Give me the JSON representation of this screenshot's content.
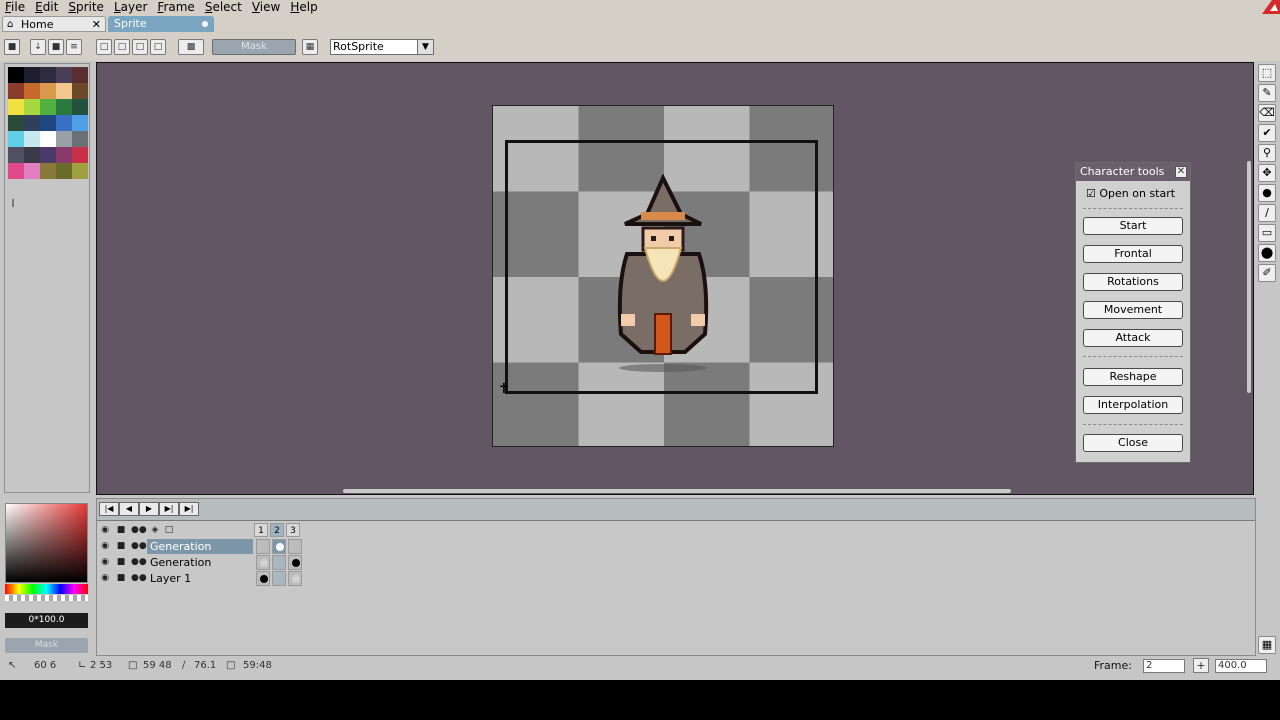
{
  "menu": [
    "File",
    "Edit",
    "Sprite",
    "Layer",
    "Frame",
    "Select",
    "View",
    "Help"
  ],
  "tabs": [
    {
      "label": "Home"
    },
    {
      "label": "Sprite"
    }
  ],
  "toolbar": {
    "mask_label": "Mask",
    "rotation_algorithm": "RotSprite"
  },
  "palette_colors": [
    "#000000",
    "#1e1e2e",
    "#2f2a3e",
    "#4a3d55",
    "#5a2e2e",
    "#8a3b2a",
    "#c56a2a",
    "#d89a4a",
    "#f0c890",
    "#6b4a2a",
    "#f0e040",
    "#a8d840",
    "#50b040",
    "#2a7a40",
    "#245040",
    "#2a4a3a",
    "#30405a",
    "#204880",
    "#3a70c8",
    "#50a0e8",
    "#60d0e8",
    "#c8e8f0",
    "#ffffff",
    "#9aa0a8",
    "#6a7078",
    "#505060",
    "#3a3a48",
    "#4a3a6a",
    "#8a3a6a",
    "#c8304a",
    "#e04a8a",
    "#e080c0",
    "#8a7a3a",
    "#6a6a2a",
    "#a0a040"
  ],
  "character_tools": {
    "title": "Character tools",
    "open_on_start": "Open on start",
    "buttons": [
      "Start",
      "Frontal",
      "Rotations",
      "Movement",
      "Attack"
    ],
    "buttons2": [
      "Reshape",
      "Interpolation"
    ],
    "close": "Close"
  },
  "color_picker": {
    "readout": "0*100.0",
    "mask_label": "Mask"
  },
  "timeline": {
    "frames": [
      "1",
      "2",
      "3"
    ],
    "layers": [
      {
        "name": "Generation",
        "selected": true
      },
      {
        "name": "Generation",
        "selected": false
      },
      {
        "name": "Layer 1",
        "selected": false
      }
    ]
  },
  "status": {
    "coords": "60 6",
    "size1": "2 53",
    "selection": "59 48",
    "angle": "76.1",
    "size2": "59:48",
    "frame_label": "Frame:",
    "frame_value": "2",
    "zoom": "400.0"
  },
  "colors": {
    "canvas_bg": "#625564",
    "panel_title": "#6a5f6c",
    "tab_active": "#79a5c0"
  }
}
